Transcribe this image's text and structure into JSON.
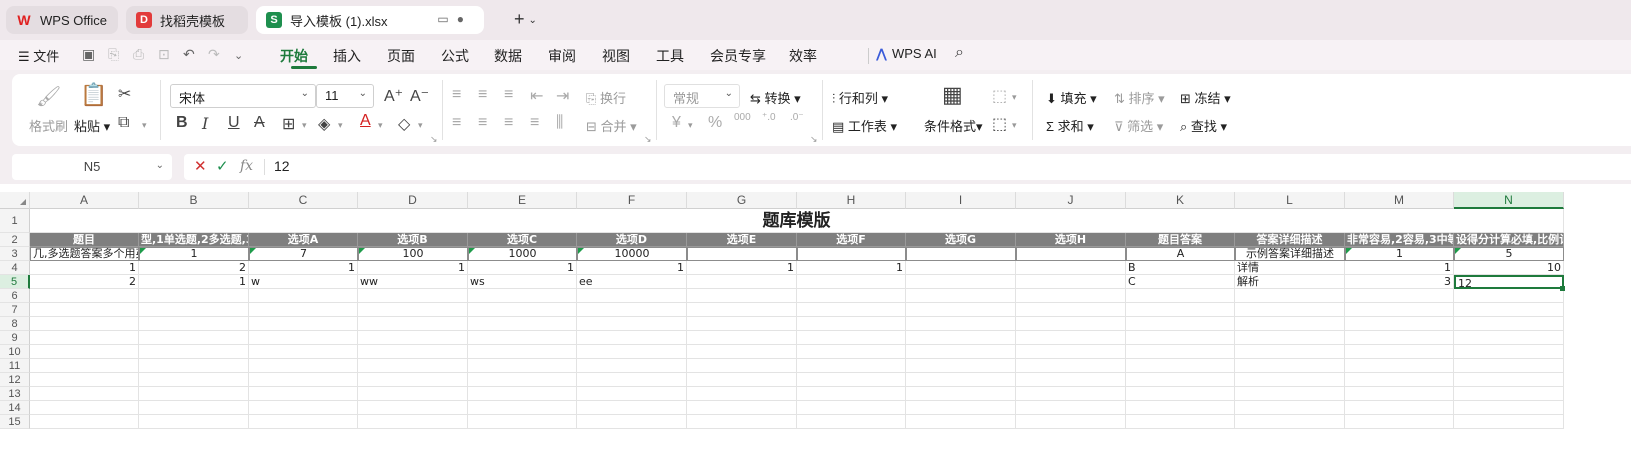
{
  "tabs": [
    {
      "label": "WPS Office",
      "icon": "wps-logo-icon"
    },
    {
      "label": "找稻壳模板",
      "icon": "docer-icon"
    },
    {
      "label": "导入模板 (1).xlsx",
      "icon": "spreadsheet-icon"
    }
  ],
  "menu": {
    "file": "文件",
    "items": [
      "开始",
      "插入",
      "页面",
      "公式",
      "数据",
      "审阅",
      "视图",
      "工具",
      "会员专享",
      "效率"
    ],
    "active": "开始",
    "wps_ai": "WPS AI"
  },
  "ribbon": {
    "format_painter": "格式刷",
    "paste": "粘贴",
    "font_name": "宋体",
    "font_size": "11",
    "wrap": "换行",
    "merge": "合并",
    "number_format": "常规",
    "convert": "转换",
    "row_col": "行和列",
    "worksheet": "工作表",
    "cond_format": "条件格式",
    "fill": "填充",
    "sort": "排序",
    "freeze": "冻结",
    "sum": "求和",
    "filter": "筛选",
    "find": "查找"
  },
  "formula_bar": {
    "name_box": "N5",
    "value": "12"
  },
  "columns": [
    "A",
    "B",
    "C",
    "D",
    "E",
    "F",
    "G",
    "H",
    "I",
    "J",
    "K",
    "L",
    "M",
    "N"
  ],
  "selected_column": "N",
  "rows": [
    "1",
    "2",
    "3",
    "4",
    "5",
    "6",
    "7",
    "8",
    "9",
    "10",
    "11",
    "12",
    "13",
    "14",
    "15"
  ],
  "selected_row": "5",
  "sheet": {
    "title": "题库模版",
    "header_row": [
      "题目",
      "型,1单选题,2多选题,3",
      "选项A",
      "选项B",
      "选项C",
      "选项D",
      "选项E",
      "选项F",
      "选项G",
      "选项H",
      "题目答案",
      "答案详细描述",
      "非常容易,2容易,3中等",
      "设得分计算必填,比例计"
    ],
    "row3": [
      "几,多选题答案多个用英",
      "1",
      "7",
      "100",
      "1000",
      "10000",
      "",
      "",
      "",
      "",
      "A",
      "示例答案详细描述",
      "1",
      "5"
    ],
    "row4": [
      "1",
      "2",
      "1",
      "1",
      "1",
      "1",
      "1",
      "1",
      "",
      "",
      "B",
      "详情",
      "1",
      "10"
    ],
    "row5": [
      "2",
      "1",
      "w",
      "ww",
      "ws",
      "ee",
      "",
      "",
      "",
      "",
      "C",
      "解析",
      "3",
      "12"
    ]
  }
}
